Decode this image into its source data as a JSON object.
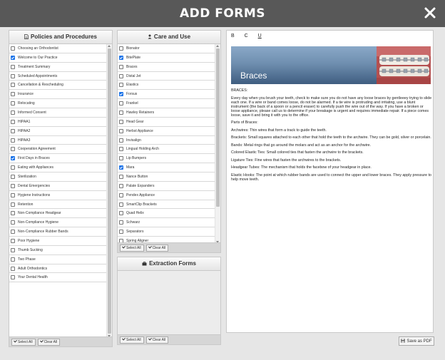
{
  "window": {
    "title": "ADD FORMS",
    "accent_color": "#1a73e8",
    "header_color": "#585858"
  },
  "policies": {
    "title": "Policies and Procedures",
    "icon": "document-icon",
    "items": [
      {
        "label": "Choosing an Orthodontist",
        "checked": false
      },
      {
        "label": "Welcome to Our Practice",
        "checked": true
      },
      {
        "label": "Treatment Summary",
        "checked": false
      },
      {
        "label": "Scheduled Appointments",
        "checked": false
      },
      {
        "label": "Cancellation & Rescheduling",
        "checked": false
      },
      {
        "label": "Insurance",
        "checked": false
      },
      {
        "label": "Relocating",
        "checked": false
      },
      {
        "label": "Informed Consent",
        "checked": false
      },
      {
        "label": "HIPAA1",
        "checked": false
      },
      {
        "label": "HIPAA2",
        "checked": false
      },
      {
        "label": "HIPAA3",
        "checked": false
      },
      {
        "label": "Cooperation Agreement",
        "checked": false
      },
      {
        "label": "First Days in Braces",
        "checked": true
      },
      {
        "label": "Eating with Appliances",
        "checked": false
      },
      {
        "label": "Sterilization",
        "checked": false
      },
      {
        "label": "Dental Emergencies",
        "checked": false
      },
      {
        "label": "Hygiene Instructions",
        "checked": false
      },
      {
        "label": "Retention",
        "checked": false
      },
      {
        "label": "Non-Compliance Headgear",
        "checked": false
      },
      {
        "label": "Non-Compliance Hygiene",
        "checked": false
      },
      {
        "label": "Non-Compliance Rubber Bands",
        "checked": false
      },
      {
        "label": "Poor Hygiene",
        "checked": false
      },
      {
        "label": "Thumb Sucking",
        "checked": false
      },
      {
        "label": "Two Phase",
        "checked": false
      },
      {
        "label": "Adult Orthodontics",
        "checked": false
      },
      {
        "label": "Your Dental Health",
        "checked": false
      }
    ],
    "select_all": "Select All",
    "clear_all": "Clear All"
  },
  "care": {
    "title": "Care and Use",
    "icon": "user-icon",
    "items": [
      {
        "label": "Bionator",
        "checked": false
      },
      {
        "label": "BitePlate",
        "checked": true
      },
      {
        "label": "Braces",
        "checked": false
      },
      {
        "label": "Distal Jet",
        "checked": false
      },
      {
        "label": "Elastics",
        "checked": false
      },
      {
        "label": "Forsus",
        "checked": true
      },
      {
        "label": "Frankel",
        "checked": false
      },
      {
        "label": "Hawley Retainers",
        "checked": false
      },
      {
        "label": "Head Gear",
        "checked": false
      },
      {
        "label": "Herbst Appliance",
        "checked": false
      },
      {
        "label": "Invisalign",
        "checked": false
      },
      {
        "label": "Lingual Holding Arch",
        "checked": false
      },
      {
        "label": "Lip Bumpers",
        "checked": false
      },
      {
        "label": "Mara",
        "checked": true
      },
      {
        "label": "Nance Button",
        "checked": false
      },
      {
        "label": "Palate Expanders",
        "checked": false
      },
      {
        "label": "Pendex Appliance",
        "checked": false
      },
      {
        "label": "SmartClip Brackets",
        "checked": false
      },
      {
        "label": "Quad Helix",
        "checked": false
      },
      {
        "label": "Schwarz",
        "checked": false
      },
      {
        "label": "Separators",
        "checked": false
      },
      {
        "label": "Spring Aligner",
        "checked": false
      }
    ],
    "select_all": "Select All",
    "clear_all": "Clear All"
  },
  "extraction": {
    "title": "Extraction Forms",
    "icon": "briefcase-icon",
    "select_all": "Select All",
    "clear_all": "Clear All"
  },
  "editor": {
    "bold": "B",
    "italic": "C",
    "underline": "U",
    "banner_title": "Braces",
    "paragraphs": [
      "BRACES:",
      "Every day when you brush your teeth, check to make sure you do not have any loose braces by gentleeey trying to slide each one. If a wire or band comes loose, do not be alarmed. If a tie wire is protruding and irritating, use a blunt instrument (the back of a spoon or a pencil eraser) to carefully push the wire out of the way. If you have a broken or loose appliance, please call us to determine if your breakage is urgent and requires immediate repair. If a piece comes loose, save it and bring it with you to the office.",
      "Parts of Braces:",
      "Archwires: Thin wires that form a track to guide the teeth.",
      "Brackets: Small squares attached to each other that hold the teeth to the archwire. They can be gold, silver or porcelain.",
      "Bands: Metal rings that go around the molars and act as an anchor for the archwire.",
      "Colored Elastic Ties: Small colored ties that fasten the archwire to the brackets.",
      "Ligature Ties: Fine wires that fasten the archwires to the brackets.",
      "Headgear Tubes: The mechanism that holds the facebow of your headgear in place.",
      "Elastic Hooks: The point at which rubber bands are used to connect the upper and lower braces. They apply pressure to help move teeth."
    ]
  },
  "footer": {
    "save_pdf": "Save as PDF"
  }
}
